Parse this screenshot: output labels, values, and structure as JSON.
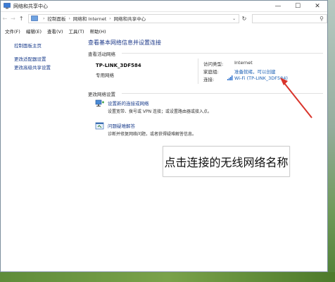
{
  "window": {
    "title": "网络和共享中心",
    "controls": {
      "minimize": "—",
      "maximize": "☐",
      "close": "✕"
    }
  },
  "address": {
    "crumbs": [
      "控制面板",
      "网络和 Internet",
      "网络和共享中心"
    ]
  },
  "menu": [
    "文件(F)",
    "编辑(E)",
    "查看(V)",
    "工具(T)",
    "帮助(H)"
  ],
  "sidebar": {
    "home": "控制面板主页",
    "links": [
      "更改适配器设置",
      "更改高级共享设置"
    ]
  },
  "main": {
    "heading": "查看基本网络信息并设置连接",
    "active_label": "查看活动网络",
    "network_name": "TP-LINK_3DF584",
    "network_type": "专用网络",
    "access_type_label": "访问类型:",
    "access_type_value": "Internet",
    "homegroup_label": "家庭组:",
    "homegroup_value": "准备就绪，可以创建",
    "connection_label": "连接:",
    "connection_value": "Wi-Fi (TP-LINK_3DF584)",
    "change_settings_label": "更改网络设置",
    "tasks": [
      {
        "title": "设置新的连接或网络",
        "desc": "设置宽带、拨号或 VPN 连接；或设置路由器或接入点。",
        "icon": "network-setup-icon"
      },
      {
        "title": "问题疑难解答",
        "desc": "诊断并修复网络问题，或者获得疑难解答信息。",
        "icon": "troubleshoot-icon"
      }
    ]
  },
  "annotation": {
    "text": "点击连接的无线网络名称",
    "arrow_color": "#d9342b"
  }
}
